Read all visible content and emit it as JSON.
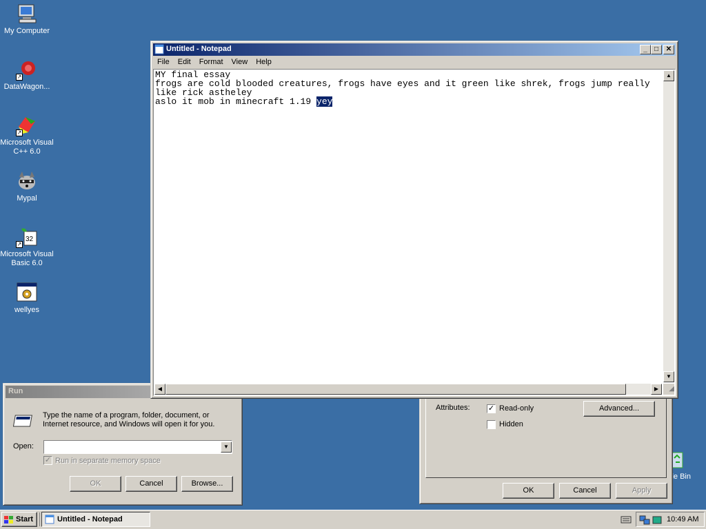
{
  "desktop": {
    "icons": [
      {
        "label": "My Computer"
      },
      {
        "label": "DataWagon..."
      },
      {
        "label": "Microsoft Visual C++ 6.0"
      },
      {
        "label": "Mypal"
      },
      {
        "label": "Microsoft Visual Basic 6.0"
      },
      {
        "label": "wellyes"
      },
      {
        "label": "cle Bin"
      }
    ]
  },
  "notepad": {
    "title": "Untitled - Notepad",
    "menu": [
      "File",
      "Edit",
      "Format",
      "View",
      "Help"
    ],
    "text_before_selection": "MY final essay\nfrogs are cold blooded creatures, frogs have eyes and it green like shrek, frogs jump really like rick astheley\naslo it mob in minecraft 1.19 ",
    "selected_text": "yey"
  },
  "run_dialog": {
    "title": "Run",
    "description": "Type the name of a program, folder, document, or Internet resource, and Windows will open it for you.",
    "open_label": "Open:",
    "open_value": "",
    "checkbox_label": "Run in separate memory space",
    "buttons": {
      "ok": "OK",
      "cancel": "Cancel",
      "browse": "Browse..."
    }
  },
  "properties_dialog": {
    "attributes_label": "Attributes:",
    "readonly_label": "Read-only",
    "readonly_checked": true,
    "hidden_label": "Hidden",
    "hidden_checked": false,
    "advanced_label": "Advanced...",
    "buttons": {
      "ok": "OK",
      "cancel": "Cancel",
      "apply": "Apply"
    }
  },
  "taskbar": {
    "start_label": "Start",
    "task_label": "Untitled - Notepad",
    "clock": "10:49 AM"
  }
}
